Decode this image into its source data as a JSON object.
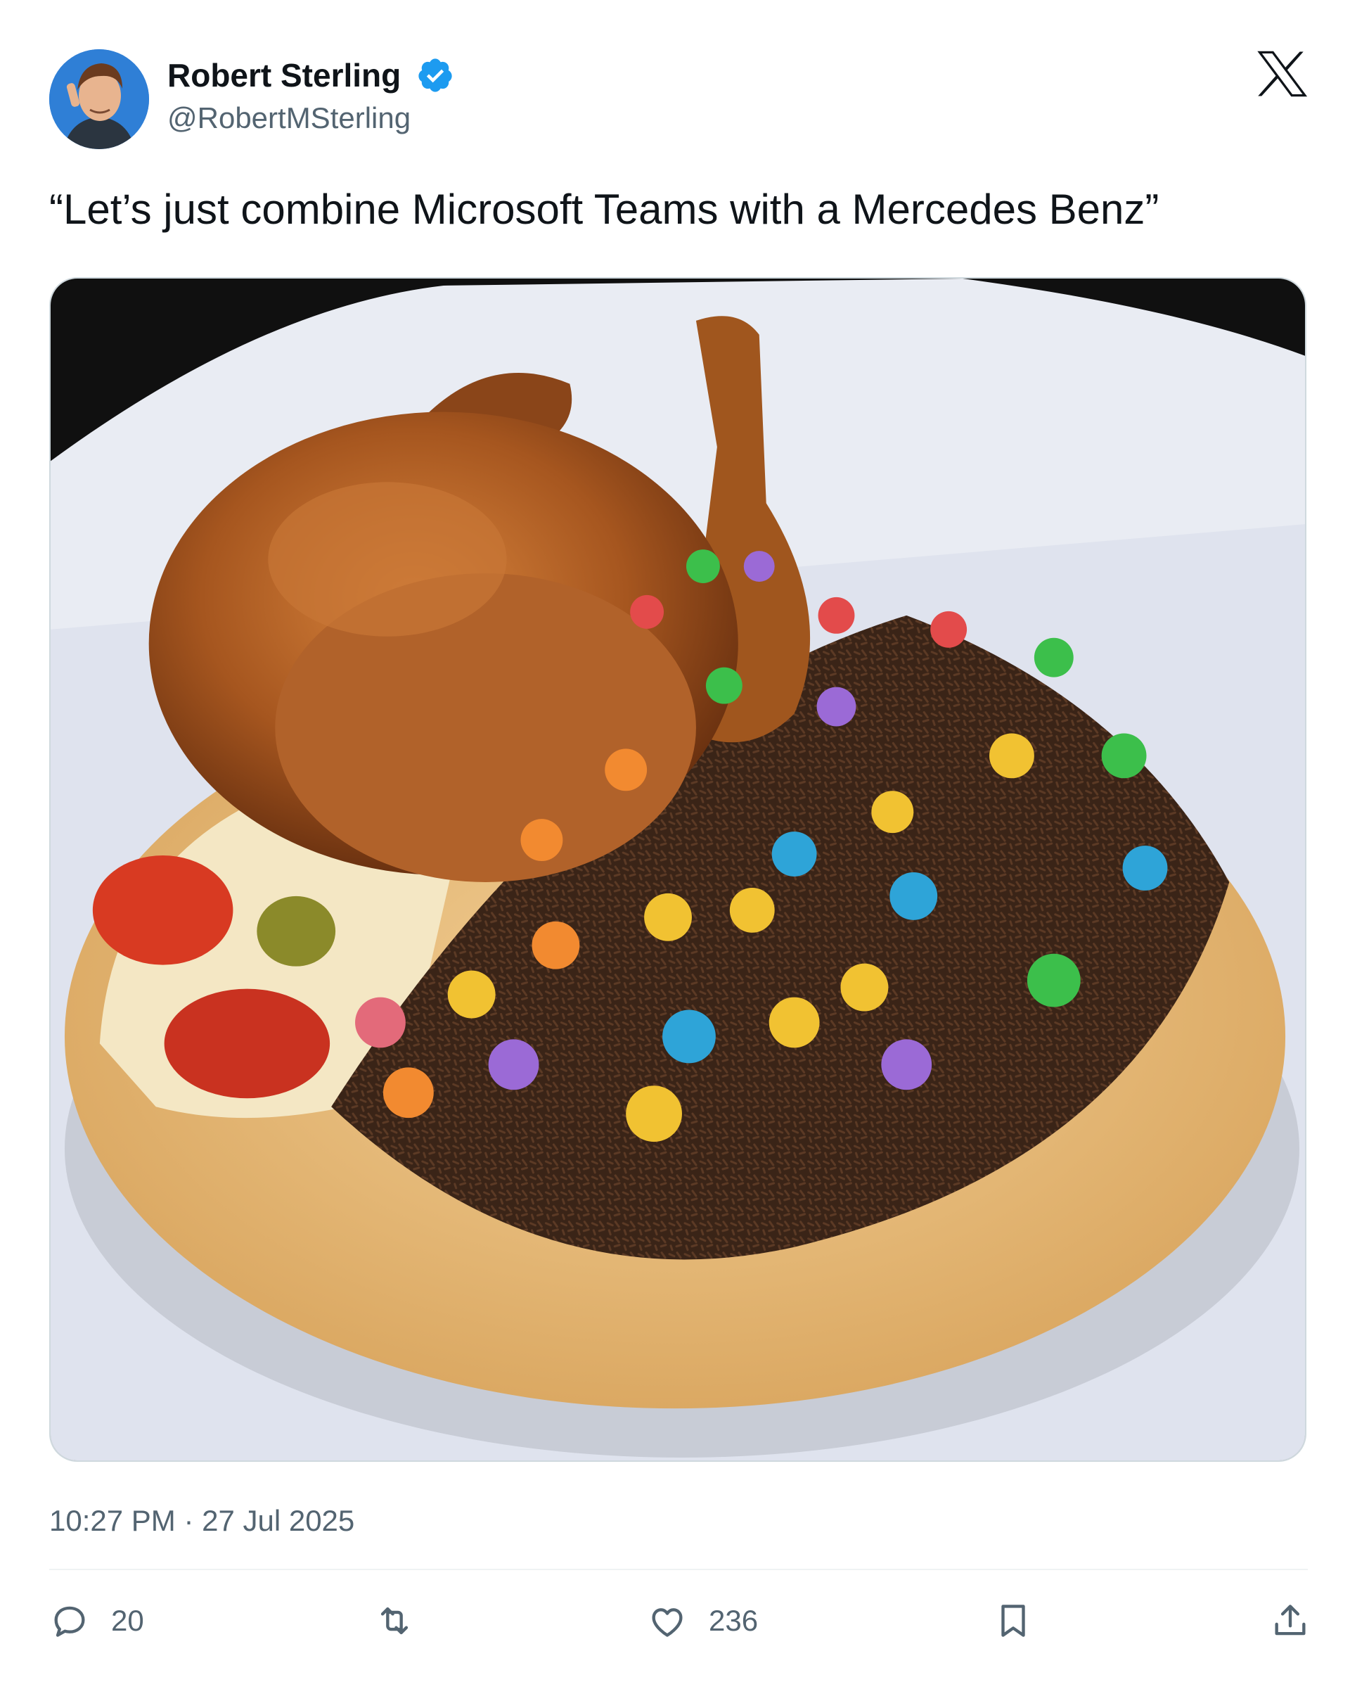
{
  "author": {
    "display_name": "Robert Sterling",
    "handle": "@RobertMSterling",
    "verified": true,
    "verified_icon": "verified-badge-icon",
    "avatar_icon": "avatar",
    "verified_color": "#1d9bf0"
  },
  "platform": {
    "logo_icon": "x-logo-icon"
  },
  "tweet": {
    "text": "“Let’s just combine Microsoft Teams with a Mercedes Benz”",
    "media_icon": "tweet-photo",
    "timestamp": "10:27 PM · 27 Jul 2025"
  },
  "actions": {
    "reply": {
      "icon": "reply-icon",
      "count": "20"
    },
    "retweet": {
      "icon": "retweet-icon",
      "count": ""
    },
    "like": {
      "icon": "like-icon",
      "count": "236"
    },
    "bookmark": {
      "icon": "bookmark-icon"
    },
    "share": {
      "icon": "share-icon"
    }
  },
  "colors": {
    "text_primary": "#0f1419",
    "text_secondary": "#536471",
    "divider": "#eff3f4"
  }
}
